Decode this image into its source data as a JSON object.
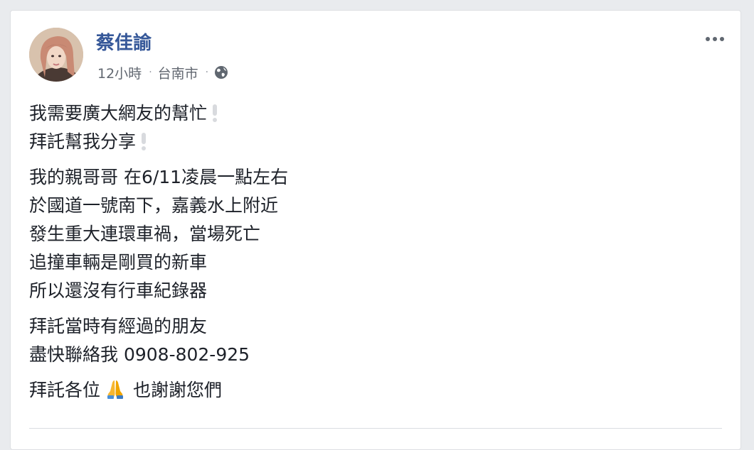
{
  "post": {
    "author": "蔡佳諭",
    "time": "12小時",
    "separator": "·",
    "location": "台南市",
    "privacy_icon": "globe-icon",
    "more_icon": "more-options-icon",
    "paragraphs": [
      {
        "lines": [
          "我需要廣大網友的幫忙",
          "拜託幫我分享"
        ]
      },
      {
        "lines": [
          "我的親哥哥 在6/11凌晨一點左右",
          "於國道一號南下，嘉義水上附近",
          "發生重大連環車禍，當場死亡",
          "追撞車輛是剛買的新車",
          "所以還沒有行車紀錄器"
        ]
      },
      {
        "lines": [
          "拜託當時有經過的朋友",
          "盡快聯絡我 0908-802-925"
        ]
      },
      {
        "before_emoji": "拜託各位",
        "emoji_icon": "folded-hands-icon",
        "after_emoji": "也謝謝您們"
      }
    ]
  },
  "colors": {
    "background": "#e9ebee",
    "card": "#ffffff",
    "author_link": "#365899",
    "body_text": "#1d2129",
    "meta_text": "#616770"
  }
}
